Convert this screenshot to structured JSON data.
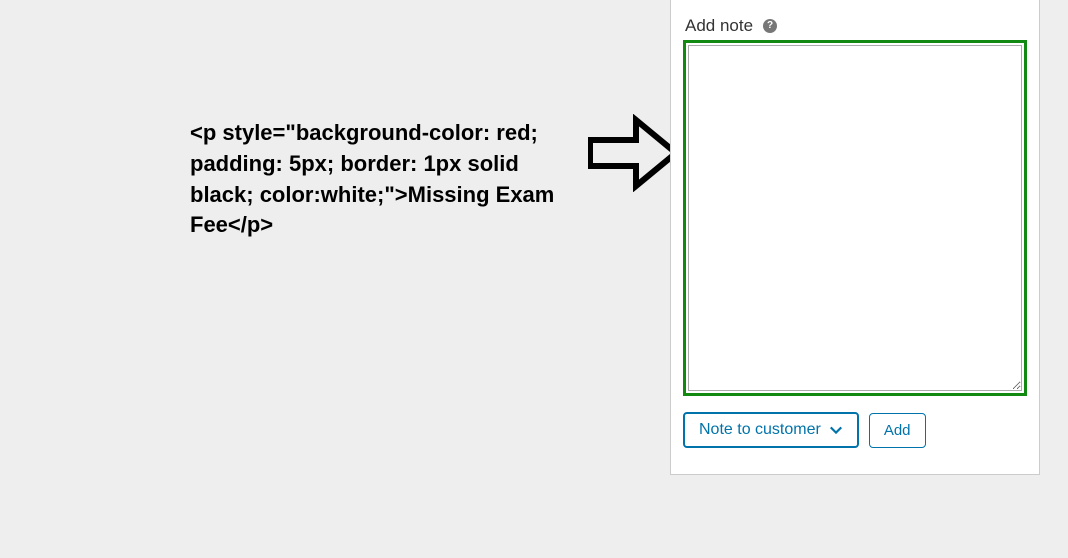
{
  "code_snippet": {
    "text": "<p style=\"background-color: red; padding: 5px; border: 1px solid black; color:white;\">Missing Exam Fee</p>"
  },
  "note_panel": {
    "header_label": "Add note",
    "help_tooltip": "?",
    "textarea_value": "",
    "note_type_selected": "Note to customer",
    "add_button_label": "Add"
  }
}
